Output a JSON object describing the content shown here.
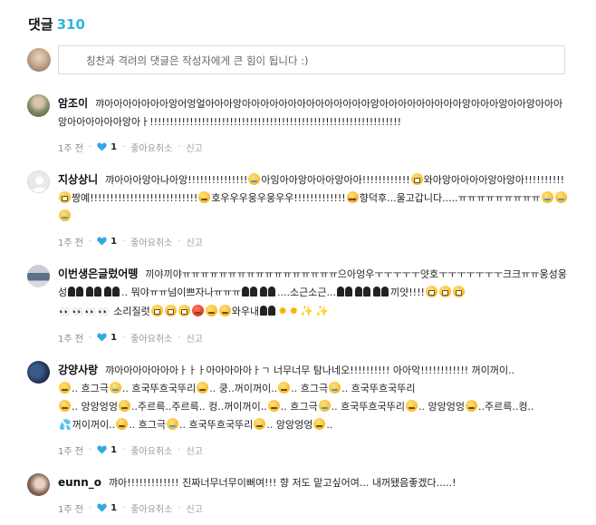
{
  "header": {
    "title": "댓글",
    "count": "310"
  },
  "composer": {
    "placeholder": "칭찬과 격려의 댓글은 작성자에게 큰 힘이 됩니다 :)"
  },
  "comment_meta": {
    "like_button": "좋아요취소",
    "report": "신고",
    "heart_icon": "heart-icon"
  },
  "comments": [
    {
      "author": "암조이",
      "time": "1주 전",
      "likes": "1",
      "text": "꺄아아아아아아아앙어엉얼아아아앙아아아아아아아아아아아아아아앙아아아아아아아아아앙아아아앙아아앙아아아앙아아아아아아앙아ㅏ!!!!!!!!!!!!!!!!!!!!!!!!!!!!!!!!!!!!!!!!!!!!!!!!!!!!!!!!!!!!!!!"
    },
    {
      "author": "지상상니",
      "time": "1주 전",
      "likes": "1",
      "t1": "꺄아아아앙아나아앙!!!!!!!!!!!!!!!",
      "t2": "아잉아아앙아아아앙아아!!!!!!!!!!!!",
      "t3": "와아앙아아아아앙아앙아!!!!!!!!!!",
      "t4": "짱예!!!!!!!!!!!!!!!!!!!!!!!!!!!",
      "t5": "호우우우웅우웅우우!!!!!!!!!!!!!",
      "t6": "향덕후...울고갑니다.....ㅠㅠㅠㅠㅠㅠㅠㅠㅠ"
    },
    {
      "author": "이번생은글렀어뗑",
      "time": "1주 전",
      "likes": "1",
      "t1": "끼야끼야ㅠㅠㅠㅠㅠㅠㅠㅠㅠㅠㅠㅠㅠㅠㅠㅠㅠ으아엉우ㅜㅜㅜㅜㅜ얏호ㅜㅜㅜㅜㅜㅜㅜ크크ㅠㅠ웅성웅성",
      "t2": ".. 뭐야ㅠㅠ넘이쁘자나ㅠㅠㅠ",
      "t3": "....소근소근...",
      "t4": "끼얏!!!!",
      "t5": "소리질럿",
      "t6": "와우내"
    },
    {
      "author": "강양사랑",
      "time": "1주 전",
      "likes": "1",
      "t1": "꺄아아아아아아아ㅏㅏㅏ아아아아아ㅏㄱ 너무너무 탐나네오!!!!!!!!!! 아아악!!!!!!!!!!!! 꺼이꺼이..",
      "t2": ".. 흐그극",
      "t3": ".. 흐국뚜흐국뚜리",
      "t4": ".. 쿵..꺼이꺼이..",
      "t5": ".. 흐그극",
      "t6": ".. 흐국뚜흐국뚜리",
      "t7": ".. 앙앙엉엉",
      "t8": "..주르륵..주르륵.. 컹..꺼이꺼이..",
      "t9": ".. 흐그극",
      "t10": ".. 흐국뚜흐국뚜리",
      "t11": ".. 앙앙엉엉",
      "t12": "..주르륵..컹..",
      "t13": "꺼이꺼이..",
      "t14": ".. 흐그극",
      "t15": ".. 흐국뚜흐국뚜리",
      "t16": ".. 앙앙엉엉",
      "t17": ".."
    },
    {
      "author": "eunn_o",
      "time": "",
      "likes": "",
      "text": "꺄아!!!!!!!!!!!!! 진짜너무너무이뻐여!!! 향 저도 맡고싶어여... 내꺼됐음좋겠다.....!"
    }
  ],
  "colors": {
    "accent": "#2fb4e0",
    "heart": "#35a8e0"
  }
}
